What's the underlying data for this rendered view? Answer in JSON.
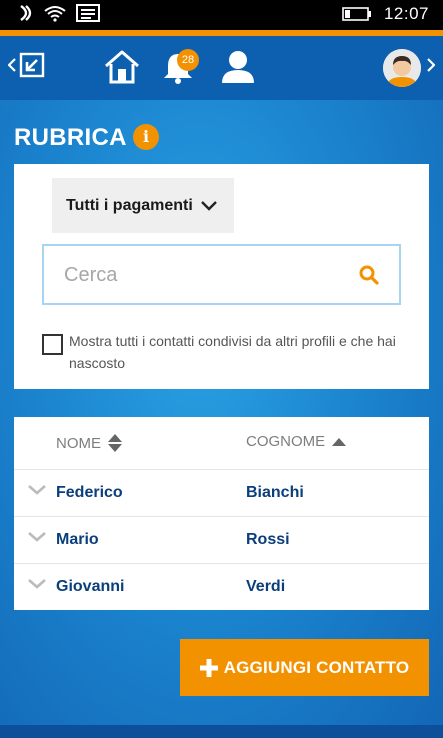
{
  "status_bar": {
    "time": "12:07",
    "icons": [
      "nfc-icon",
      "wifi-icon",
      "message-icon",
      "battery-icon"
    ]
  },
  "nav": {
    "icons": [
      "back-chevron-icon",
      "logout-icon",
      "home-icon",
      "bell-icon",
      "user-icon",
      "avatar",
      "more-chevron-icon"
    ],
    "notifications_count": "28"
  },
  "page": {
    "title": "RUBRICA",
    "info_icon": "i"
  },
  "filter": {
    "dropdown_label": "Tutti i pagamenti",
    "search_placeholder": "Cerca",
    "search_value": "",
    "checkbox_label": "Mostra tutti i contatti condivisi da altri profili e che hai nascosto",
    "checkbox_checked": false
  },
  "table": {
    "headers": {
      "first_name": "NOME",
      "last_name": "COGNOME"
    },
    "rows": [
      {
        "first": "Federico",
        "last": "Bianchi"
      },
      {
        "first": "Mario",
        "last": "Rossi"
      },
      {
        "first": "Giovanni",
        "last": "Verdi"
      }
    ]
  },
  "actions": {
    "add_contact_label": "AGGIUNGI CONTATTO",
    "add_contact_icon": "plus-icon"
  },
  "colors": {
    "accent": "#f39200",
    "navbar": "#0d5fb0",
    "name_text": "#0b3f7c"
  }
}
